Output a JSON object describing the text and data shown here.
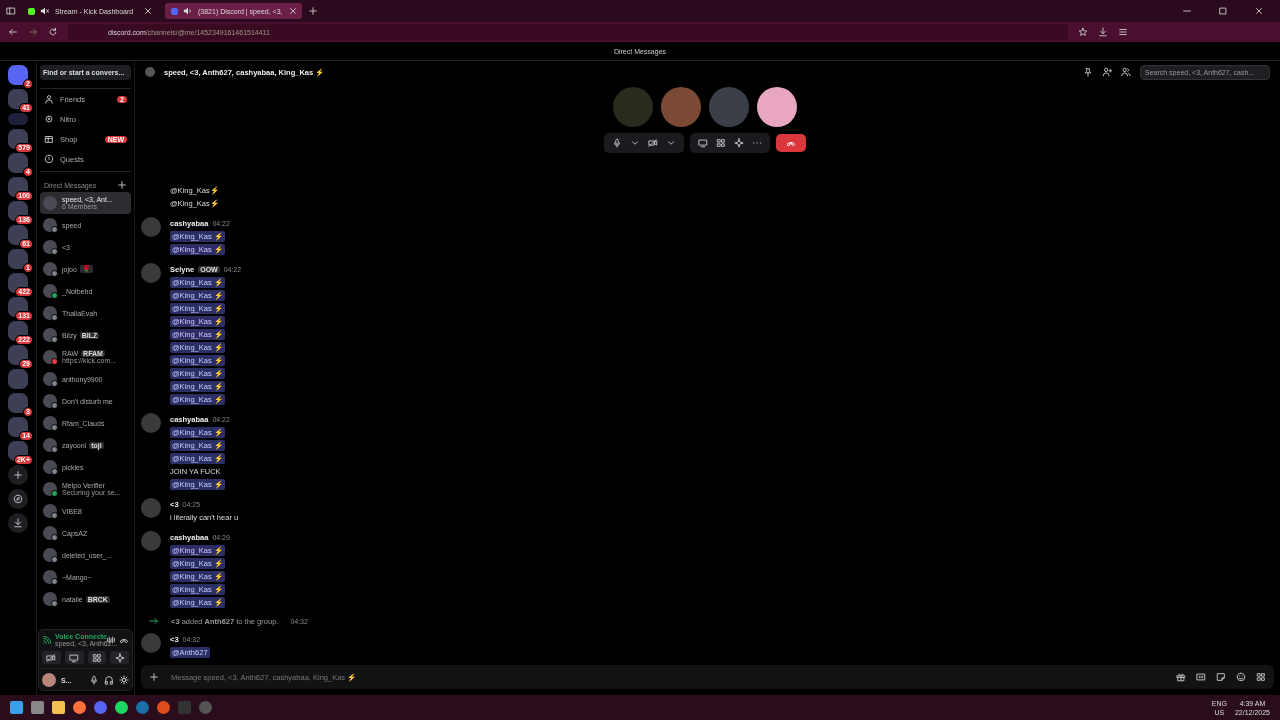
{
  "browser": {
    "tabs": [
      {
        "title": "Stream - Kick Dashboard",
        "selected": false,
        "muted": true
      },
      {
        "title": "(3821) Discord | speed, <3,",
        "selected": true,
        "muted": false
      }
    ],
    "url": {
      "domain": "discord.com",
      "path": "/channels/@me/1452349161461514411"
    }
  },
  "app": {
    "title": "Direct Messages"
  },
  "servers": [
    {
      "badge": "2",
      "kind": "home"
    },
    {
      "badge": "41",
      "kind": "server"
    },
    {
      "kind": "folder"
    },
    {
      "badge": "579",
      "kind": "server"
    },
    {
      "badge": "4",
      "kind": "server"
    },
    {
      "badge": "100",
      "kind": "server"
    },
    {
      "badge": "136",
      "kind": "server"
    },
    {
      "badge": "61",
      "kind": "server"
    },
    {
      "badge": "1",
      "kind": "server"
    },
    {
      "badge": "422",
      "kind": "server"
    },
    {
      "badge": "131",
      "kind": "server"
    },
    {
      "badge": "222",
      "kind": "server"
    },
    {
      "badge": "29",
      "kind": "server"
    },
    {
      "kind": "server"
    },
    {
      "badge": "3",
      "kind": "server"
    },
    {
      "badge": "14",
      "kind": "server"
    },
    {
      "badge": "2K+",
      "kind": "server"
    },
    {
      "kind": "add"
    },
    {
      "kind": "discover"
    },
    {
      "kind": "download"
    }
  ],
  "sidebar": {
    "search": {
      "placeholder": "Find or start a convers..."
    },
    "nav": [
      {
        "label": "Friends",
        "badge": "2",
        "kind": "friends"
      },
      {
        "label": "Nitro",
        "kind": "nitro"
      },
      {
        "label": "Shop",
        "badge": "NEW",
        "kind": "shop"
      },
      {
        "label": "Quests",
        "kind": "quests"
      }
    ],
    "section": "Direct Messages",
    "dms": [
      {
        "name": "speed, <3, Ant...",
        "subtitle": "6 Members",
        "selected": true
      },
      {
        "name": "speed",
        "selected": false,
        "color": "#80848e"
      },
      {
        "name": "<3",
        "selected": false,
        "color": "#80848e"
      },
      {
        "name": "jojoo",
        "tag": "🌹",
        "selected": false,
        "color": "#80848e"
      },
      {
        "name": "_Notbehd",
        "selected": false,
        "color": "#23a55a"
      },
      {
        "name": "ThaliaEvah",
        "selected": false,
        "color": "#80848e"
      },
      {
        "name": "Bilzy",
        "tag": "BILZ",
        "selected": false,
        "color": "#80848e"
      },
      {
        "name": "RAW",
        "subtitle": "https://kick.com...",
        "tag": "RFAM",
        "selected": false,
        "color": "#f23f43"
      },
      {
        "name": "anthony9900",
        "selected": false,
        "color": "#80848e"
      },
      {
        "name": "Don't disturb me",
        "selected": false,
        "color": "#80848e"
      },
      {
        "name": "Rfam_Clauds",
        "selected": false,
        "color": "#80848e"
      },
      {
        "name": "zayooni",
        "tag": "toji",
        "selected": false,
        "color": "#80848e"
      },
      {
        "name": "pickles",
        "selected": false,
        "color": "#80848e"
      },
      {
        "name": "Melpo Verifier",
        "subtitle": "Securing your se...",
        "selected": false,
        "color": "#23a55a"
      },
      {
        "name": "VIBE8",
        "selected": false,
        "color": "#80848e"
      },
      {
        "name": "CapsAZ",
        "selected": false,
        "color": "#80848e"
      },
      {
        "name": "deleted_user_...",
        "selected": false,
        "color": "#80848e"
      },
      {
        "name": "~Mango~",
        "selected": false,
        "color": "#80848e"
      },
      {
        "name": "natalie",
        "tag": "BRCK",
        "selected": false,
        "color": "#80848e"
      }
    ],
    "voice": {
      "status": "Voice Connecte",
      "channel": "speed, <3, Anth62..."
    },
    "user": {
      "name": "S..."
    }
  },
  "chat": {
    "title": "speed, <3, Anth627, cashyabaa, King_Kas ⚡",
    "search": {
      "placeholder": "Search speed, <3, Anth627, cash..."
    },
    "messages": [
      {
        "kind": "group",
        "lines": [
          {
            "kind": "text",
            "text": "@King_Kas⚡"
          },
          {
            "kind": "text",
            "text": "@King_Kas⚡"
          }
        ]
      },
      {
        "kind": "group",
        "author": "cashyabaa",
        "time": "04:22",
        "lines": [
          {
            "kind": "mention",
            "text": "@King_Kas ⚡"
          },
          {
            "kind": "mention",
            "text": "@King_Kas ⚡"
          }
        ]
      },
      {
        "kind": "group",
        "author": "Selyne",
        "tag": "OOW",
        "time": "04:22",
        "lines": [
          {
            "kind": "mention",
            "text": "@King_Kas ⚡"
          },
          {
            "kind": "mention",
            "text": "@King_Kas ⚡"
          },
          {
            "kind": "mention",
            "text": "@King_Kas ⚡"
          },
          {
            "kind": "mention",
            "text": "@King_Kas ⚡"
          },
          {
            "kind": "mention",
            "text": "@King_Kas ⚡"
          },
          {
            "kind": "mention",
            "text": "@King_Kas ⚡"
          },
          {
            "kind": "mention",
            "text": "@King_Kas ⚡"
          },
          {
            "kind": "mention",
            "text": "@King_Kas ⚡"
          },
          {
            "kind": "mention",
            "text": "@King_Kas ⚡"
          },
          {
            "kind": "mention",
            "text": "@King_Kas ⚡"
          }
        ]
      },
      {
        "kind": "group",
        "author": "cashyabaa",
        "time": "04:22",
        "lines": [
          {
            "kind": "mention",
            "text": "@King_Kas ⚡"
          },
          {
            "kind": "mention",
            "text": "@King_Kas ⚡"
          },
          {
            "kind": "mention",
            "text": "@King_Kas ⚡"
          },
          {
            "kind": "text",
            "text": "JOIN YA FUCK"
          },
          {
            "kind": "mention",
            "text": "@King_Kas ⚡"
          }
        ]
      },
      {
        "kind": "group",
        "author": "<3",
        "time": "04:25",
        "lines": [
          {
            "kind": "text",
            "text": "i literally can't hear u"
          }
        ]
      },
      {
        "kind": "group",
        "author": "cashyabaa",
        "time": "04:29",
        "lines": [
          {
            "kind": "mention",
            "text": "@King_Kas ⚡"
          },
          {
            "kind": "mention",
            "text": "@King_Kas ⚡"
          },
          {
            "kind": "mention",
            "text": "@King_Kas ⚡"
          },
          {
            "kind": "mention",
            "text": "@King_Kas ⚡"
          },
          {
            "kind": "mention",
            "text": "@King_Kas ⚡"
          }
        ]
      },
      {
        "kind": "system",
        "text": "**<3** added **Anth627** to the group.",
        "time": "04:32"
      },
      {
        "kind": "group",
        "author": "<3",
        "time": "04:32",
        "lines": [
          {
            "kind": "mention",
            "text": "@Anth627"
          }
        ]
      }
    ],
    "composer": {
      "placeholder": "Message speed, <3, Anth627, cashyabaa, King_Kas ⚡"
    }
  },
  "taskbar": {
    "language": "ENG",
    "region": "US",
    "time": "4:39 AM",
    "date": "22/12/2025"
  }
}
